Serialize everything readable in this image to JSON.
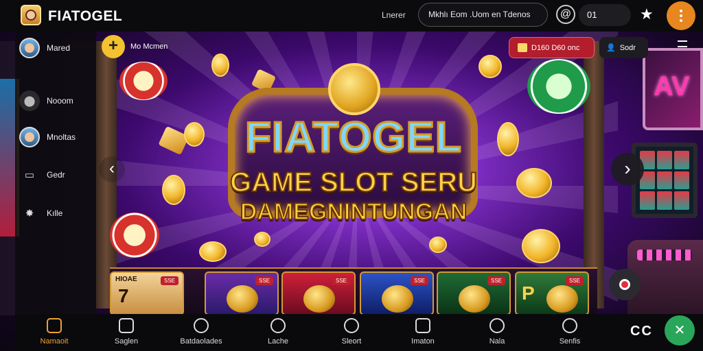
{
  "header": {
    "brand": "FIATOGEL",
    "label": "Lnerer",
    "search_text": "Mkhlı Eom .Uom en Tdenos",
    "counter": "01"
  },
  "sidebar": {
    "items": [
      {
        "label": "Mared",
        "icon": "avatar"
      },
      {
        "label": "Nooom",
        "icon": "location-pin-icon"
      },
      {
        "label": "Mnoltas",
        "icon": "avatar"
      },
      {
        "label": "Gedr",
        "icon": "card-icon"
      },
      {
        "label": "Kılle",
        "icon": "fire-icon"
      }
    ]
  },
  "topbar": {
    "add_label": "Mo Mcmen",
    "promo_label": "D160 D60 onc",
    "user_label": "Sodr"
  },
  "hero": {
    "title": "FIATOGEL",
    "line1": "GAME SLOT SERU",
    "line2": "DAMEGNINTUNGAN"
  },
  "cards": [
    {
      "caption": "HIOAE",
      "big": "7",
      "badge": "SSE"
    },
    {
      "caption": "",
      "big": "",
      "badge": "SSE"
    },
    {
      "caption": "",
      "big": "",
      "badge": "SSE"
    },
    {
      "caption": "",
      "big": "",
      "badge": "SSE"
    },
    {
      "caption": "",
      "big": "",
      "badge": "SSE"
    },
    {
      "caption": "",
      "big": "P",
      "badge": "SSE"
    }
  ],
  "bottom_nav": [
    {
      "label": "Namaoit"
    },
    {
      "label": "Saglen"
    },
    {
      "label": "Batdaolades"
    },
    {
      "label": "Lache"
    },
    {
      "label": "Sleort"
    },
    {
      "label": "Imaton"
    },
    {
      "label": "Nala"
    },
    {
      "label": "Senfis"
    }
  ],
  "bottom_glyph": "CC",
  "colors": {
    "accent": "#f0a030",
    "promo": "#b31d2c",
    "fab": "#2aa65a"
  }
}
